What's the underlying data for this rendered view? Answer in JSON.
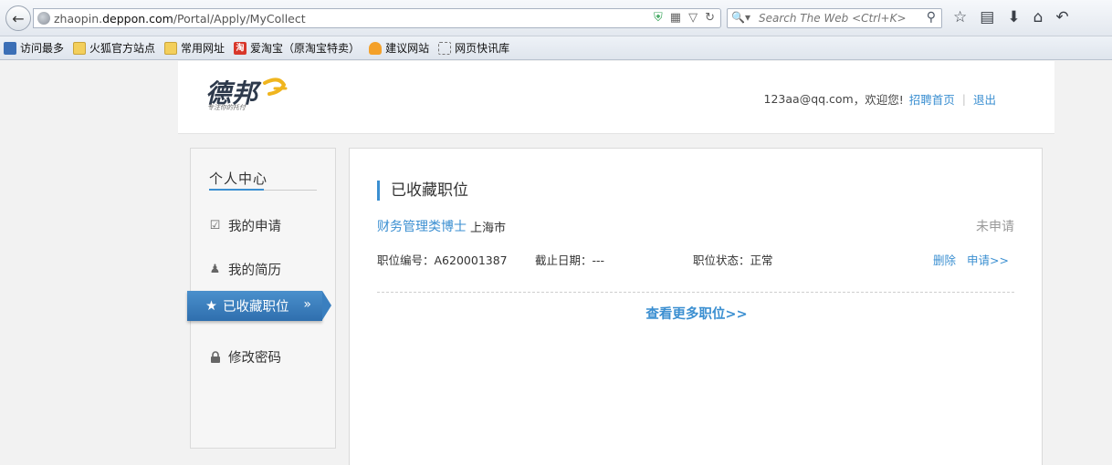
{
  "browser": {
    "url_prefix": "zhaopin.",
    "url_domain": "deppon.com",
    "url_path": "/Portal/Apply/MyCollect",
    "search_placeholder": "Search The Web <Ctrl+K>"
  },
  "bookmarks": [
    {
      "label": "访问最多",
      "icon": "bookmark-icon"
    },
    {
      "label": "火狐官方站点",
      "icon": "folder-icon"
    },
    {
      "label": "常用网址",
      "icon": "folder-icon"
    },
    {
      "label": "爱淘宝（原淘宝特卖）",
      "icon": "taobao-icon"
    },
    {
      "label": "建议网站",
      "icon": "bulb-icon"
    },
    {
      "label": "网页快讯库",
      "icon": "webslice-icon"
    }
  ],
  "header": {
    "logo_text": "德邦",
    "logo_tagline": "专注你的托付",
    "user_email": "123aa@qq.com",
    "welcome": "，欢迎您!",
    "home_link": "招聘首页",
    "separator": "|",
    "logout_link": "退出"
  },
  "sidebar": {
    "title": "个人中心",
    "items": [
      {
        "label": "我的申请",
        "icon": "checkbox-icon"
      },
      {
        "label": "我的简历",
        "icon": "user-icon"
      },
      {
        "label": "已收藏职位",
        "icon": "star-icon",
        "active": true,
        "chevron": "»"
      },
      {
        "label": "修改密码",
        "icon": "lock-icon"
      }
    ]
  },
  "main": {
    "title": "已收藏职位",
    "job": {
      "title": "财务管理类博士",
      "city": "上海市",
      "status": "未申请",
      "code": "职位编号：A620001387",
      "deadline": "截止日期：---",
      "state": "职位状态：正常",
      "delete": "删除",
      "apply": "申请>>"
    },
    "more_link": "查看更多职位>>"
  },
  "colors": {
    "accent": "#3b8fd1",
    "active_nav": "#3a7fbf"
  }
}
